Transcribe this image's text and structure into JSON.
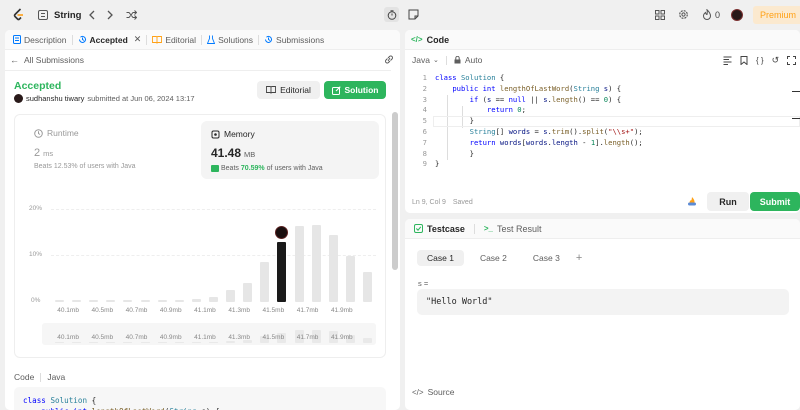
{
  "topbar": {
    "problem_list_label": "String",
    "coins": "0",
    "premium_label": "Premium"
  },
  "left_tabs": [
    {
      "label": "Description"
    },
    {
      "label": "Accepted"
    },
    {
      "label": "Editorial"
    },
    {
      "label": "Solutions"
    },
    {
      "label": "Submissions"
    }
  ],
  "submission": {
    "back_label": "All Submissions",
    "status": "Accepted",
    "user": "sudhanshu tiwary",
    "submitted_text": "submitted at Jun 06, 2024 13:17",
    "editorial_btn": "Editorial",
    "solution_btn": "Solution"
  },
  "runtime": {
    "label": "Runtime",
    "value": "2",
    "unit": "ms",
    "beats_text": "Beats 12.53% of users with Java"
  },
  "memory": {
    "label": "Memory",
    "value": "41.48",
    "unit": "MB",
    "beats_prefix": "Beats",
    "beats_pct": "70.59%",
    "beats_suffix": "of users with Java"
  },
  "chart_data": {
    "type": "bar",
    "yticks": [
      "20%",
      "10%",
      "0%"
    ],
    "ylim": [
      0,
      20
    ],
    "xticks": [
      "40.1mb",
      "40.5mb",
      "40.7mb",
      "40.9mb",
      "41.1mb",
      "41.3mb",
      "41.5mb",
      "41.7mb",
      "41.9mb"
    ],
    "values": [
      0.3,
      0.3,
      0.3,
      0.3,
      0.4,
      0.4,
      0.3,
      0.5,
      0.6,
      1,
      2.5,
      4,
      8.5,
      13,
      16.3,
      16.5,
      14.5,
      10,
      6.4
    ],
    "highlight_index": 13,
    "colors": {
      "bar": "#e6e6e6",
      "highlight": "#1a1a1a"
    }
  },
  "code_section": {
    "label": "Code",
    "lang": "Java"
  },
  "code_preview": [
    "class Solution {",
    "    public int lengthOfLastWord(String s) {",
    "        if (s == null || s.length() == 0) {"
  ],
  "editor": {
    "title": "Code",
    "language": "Java",
    "auto_label": "Auto",
    "status": "Ln 9, Col 9",
    "saved": "Saved",
    "run_label": "Run",
    "submit_label": "Submit",
    "lines": [
      "class Solution {",
      "    public int lengthOfLastWord(String s) {",
      "        if (s == null || s.length() == 0) {",
      "            return 0;",
      "        }",
      "        String[] words = s.trim().split(\"\\\\s+\");",
      "        return words[words.length - 1].length();",
      "        }",
      "}"
    ],
    "line_numbers": [
      "1",
      "2",
      "3",
      "4",
      "5",
      "6",
      "7",
      "8",
      "9"
    ]
  },
  "testcase": {
    "tab_label": "Testcase",
    "result_label": "Test Result",
    "cases": [
      "Case 1",
      "Case 2",
      "Case 3"
    ],
    "add_label": "+",
    "var_label": "s =",
    "value": "\"Hello World\"",
    "source_label": "Source"
  },
  "colors": {
    "accepted": "#2db55d",
    "solution_btn": "#2db55d",
    "premium": "#ffa116",
    "accent_orange": "#ffa116"
  }
}
